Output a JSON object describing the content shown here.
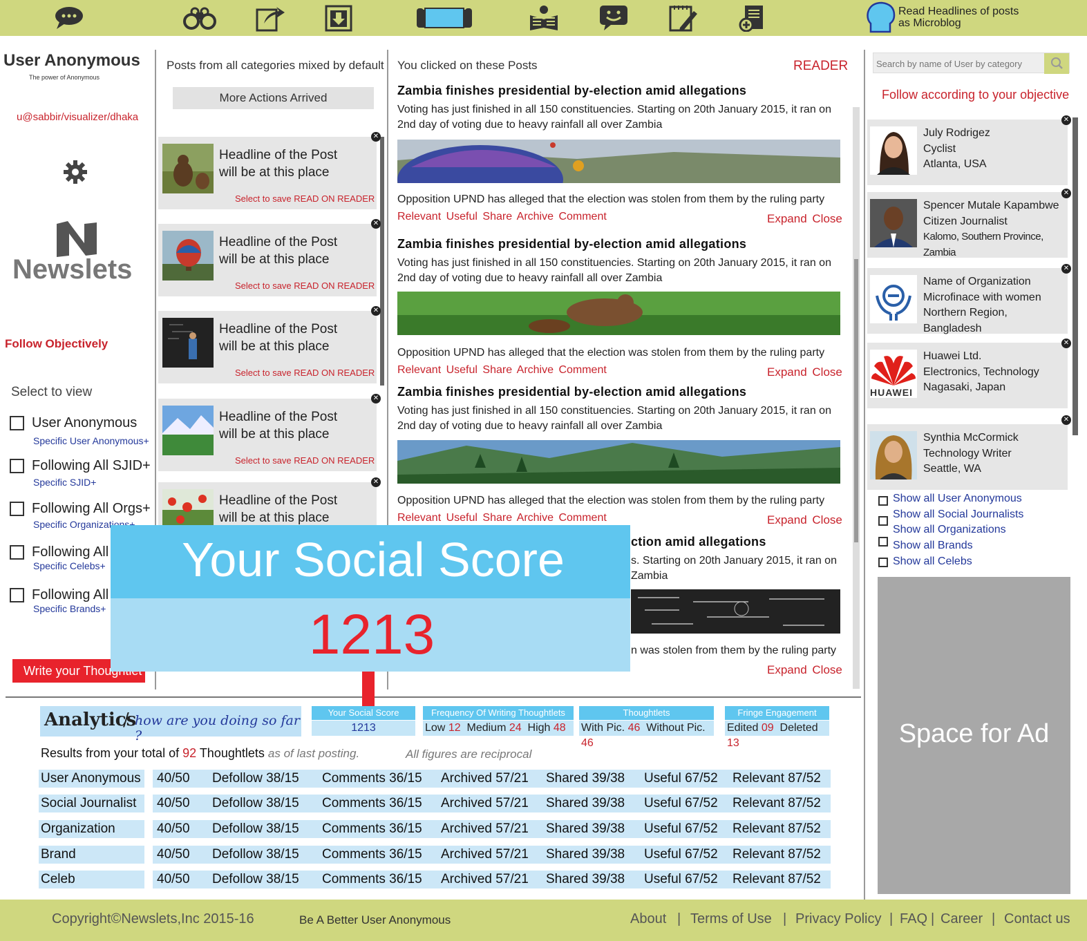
{
  "topbar": {
    "icons": [
      "chat-bubbles-icon",
      "binoculars-icon",
      "share-edit-icon",
      "download-box-icon",
      "tablet-stack-icon",
      "reader-person-icon",
      "smiley-chat-icon",
      "notepad-edit-icon",
      "add-document-icon"
    ],
    "read_headlines_line1": "Read Headlines of posts",
    "read_headlines_line2": "as Microblog"
  },
  "left": {
    "user_name": "User Anonymous",
    "tagline": "The power of Anonymous",
    "user_path": "u@sabbir/visualizer/dhaka",
    "logo_text": "Newslets",
    "follow_heading": "Follow Objectively",
    "select_to_view": "Select to view",
    "filters": [
      {
        "label": "User Anonymous",
        "sub": "Specific User Anonymous+"
      },
      {
        "label": "Following All SJID+",
        "sub": "Specific SJID+"
      },
      {
        "label": "Following All Orgs+",
        "sub": "Specific Organizations+"
      },
      {
        "label": "Following All B",
        "sub": "Specific Celebs+"
      },
      {
        "label": "Following All C",
        "sub": "Specific Brands+"
      }
    ],
    "write_button": "Write your Thoughtlet"
  },
  "feed": {
    "header": "Posts from all categories mixed by default",
    "more_actions": "More Actions Arrived",
    "cards": [
      {
        "line1": "Headline of the Post",
        "line2": "will be at this place",
        "save": "Select to save READ ON READER"
      },
      {
        "line1": "Headline of the Post",
        "line2": "will be at this place",
        "save": "Select to save READ ON READER"
      },
      {
        "line1": "Headline of the Post",
        "line2": "will be at this place",
        "save": "Select to save READ ON READER"
      },
      {
        "line1": "Headline of the Post",
        "line2": "will be at this place",
        "save": "Select to save READ ON READER"
      },
      {
        "line1": "Headline of the Post",
        "line2": "will be at this place",
        "save": ""
      }
    ]
  },
  "reader": {
    "header": "You clicked on these Posts",
    "label": "READER",
    "articles": [
      {
        "title": "Zambia finishes presidential by-election amid allegations",
        "body1": "Voting has just finished in all 150 constituencies. Starting on 20th January 2015, it ran on",
        "body2": "2nd day of voting due to heavy rainfall all over Zambia",
        "after": "Opposition UPND has alleged that the election was stolen from them by the ruling party",
        "actions": "Relevant Useful Share Archive Comment",
        "expand": "Expand",
        "close": "Close"
      },
      {
        "title": "Zambia finishes presidential by-election amid allegations",
        "body1": "Voting has just finished in all 150 constituencies. Starting on 20th January 2015, it ran on",
        "body2": "2nd day of voting due to heavy rainfall all over Zambia",
        "after": "Opposition UPND has alleged that the election was stolen from them by the ruling party",
        "actions": "Relevant Useful Share Archive Comment",
        "expand": "Expand",
        "close": "Close"
      },
      {
        "title": "Zambia finishes presidential by-election amid allegations",
        "body1": "Voting has just finished in all 150 constituencies. Starting on 20th January 2015, it ran on",
        "body2": "2nd day of voting due to heavy rainfall all over Zambia",
        "after": "Opposition UPND has alleged that the election was stolen from them by the ruling party",
        "actions": "Relevant Useful Share Archive Comment",
        "expand": "Expand",
        "close": "Close"
      },
      {
        "title": "ction amid allegations",
        "body1": "s. Starting on 20th January 2015, it ran on",
        "body2": "Zambia",
        "after": "n was stolen from them by the ruling party",
        "actions": "",
        "expand": "Expand",
        "close": "Close"
      }
    ]
  },
  "right": {
    "search_placeholder": "Search by name of User by category",
    "follow_text": "Follow according to your objective",
    "people": [
      {
        "name": "July Rodrigez",
        "role": "Cyclist",
        "place": "Atlanta, USA"
      },
      {
        "name": "Spencer Mutale Kapambwe",
        "role": "Citizen Journalist",
        "place": "Kalomo, Southern Province, Zambia"
      },
      {
        "name": "Name of Organization",
        "role": "Microfinace with women",
        "place": "Northern Region, Bangladesh"
      },
      {
        "name": "Huawei Ltd.",
        "role": "Electronics, Technology",
        "place": "Nagasaki, Japan",
        "logo_text": "HUAWEI"
      },
      {
        "name": "Synthia McCormick",
        "role": "Technology Writer",
        "place": "Seattle, WA"
      }
    ],
    "show_all": [
      "Show all User Anonymous",
      "Show all Social Journalists",
      "Show all Organizations",
      "Show all Brands",
      "Show all Celebs"
    ],
    "ad_text": "Space for Ad"
  },
  "popup": {
    "title": "Your Social Score",
    "score": "1213"
  },
  "analytics": {
    "title": "Analytics",
    "slash": "/",
    "subtitle": "how are you doing so far ?",
    "boxes": {
      "score_head": "Your Social Score",
      "score_val": "1213",
      "freq_head": "Frequency Of Writing Thoughtlets",
      "freq_low_l": "Low",
      "freq_low": "12",
      "freq_med_l": "Medium",
      "freq_med": "24",
      "freq_high_l": "High",
      "freq_high": "48",
      "th_head": "Thoughtlets",
      "th_pic_l": "With Pic.",
      "th_pic": "46",
      "th_nopic_l": "Without Pic.",
      "th_nopic": "46",
      "fr_head": "Fringe Engagement",
      "fr_ed_l": "Edited",
      "fr_ed": "09",
      "fr_del_l": "Deleted",
      "fr_del": "13"
    },
    "results_prefix": "Results from your total of",
    "results_total": "92",
    "results_word": "Thoughtlets",
    "results_suffix": "as of last posting.",
    "reciprocal_note": "All figures are reciprocal",
    "rows": [
      {
        "label": "User Anonymous"
      },
      {
        "label": "Social Journalist"
      },
      {
        "label": "Organization"
      },
      {
        "label": "Brand"
      },
      {
        "label": "Celeb"
      }
    ],
    "metrics": {
      "m0_a": "40",
      "m0_b": "/50",
      "m1_l": "Defollow",
      "m1_a": "38",
      "m1_b": "/15",
      "m2_l": "Comments",
      "m2_a": "36",
      "m2_b": "/15",
      "m3_l": "Archived",
      "m3_a": "57",
      "m3_b": "/21",
      "m4_l": "Shared",
      "m4_a": "39",
      "m4_b": "/38",
      "m5_l": "Useful",
      "m5_a": "67",
      "m5_b": "/52",
      "m6_l": "Relevant",
      "m6_a": "87",
      "m6_b": "/52"
    }
  },
  "footer": {
    "copyright": "Copyright©Newslets,Inc 2015-16",
    "slogan": "Be A Better User Anonymous",
    "links": [
      "About",
      "|",
      "Terms of Use",
      "|",
      "Privacy Policy",
      "|",
      "FAQ",
      "|",
      "Career",
      "|",
      "Contact us"
    ]
  },
  "colors": {
    "topbar": "#cfd77f",
    "accent_red": "#c8232c",
    "accent_blue": "#5fc6ef",
    "popup_blue": "#5fc6ef"
  }
}
